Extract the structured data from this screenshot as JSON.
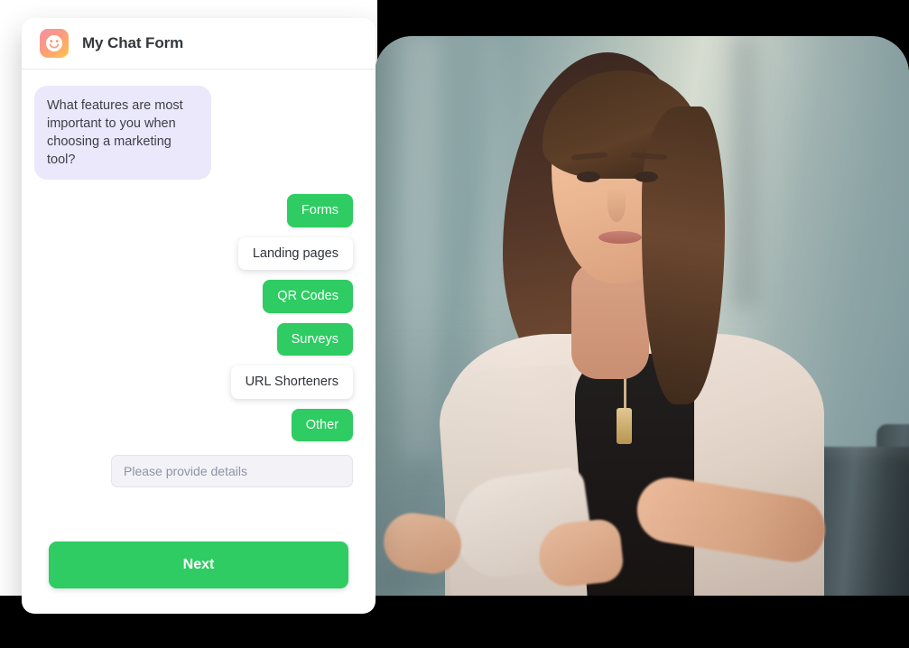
{
  "card": {
    "brand_icon": "smiley-face-icon",
    "title": "My Chat Form",
    "question": "What features are most important to you when choosing a marketing tool?",
    "options": [
      {
        "label": "Forms",
        "selected": true
      },
      {
        "label": "Landing pages",
        "selected": false
      },
      {
        "label": "QR Codes",
        "selected": true
      },
      {
        "label": "Surveys",
        "selected": true
      },
      {
        "label": "URL Shorteners",
        "selected": false
      },
      {
        "label": "Other",
        "selected": true
      }
    ],
    "details_input": {
      "placeholder": "Please provide details",
      "value": ""
    },
    "next_label": "Next"
  },
  "photo": {
    "alt": "Smiling woman seated in an office chair in a blurred office interior"
  },
  "colors": {
    "accent_green": "#2ecc62",
    "question_bubble": "#ebe8fb",
    "input_background": "#f2f2f7",
    "title_text": "#33383c",
    "backdrop": "#000000"
  }
}
